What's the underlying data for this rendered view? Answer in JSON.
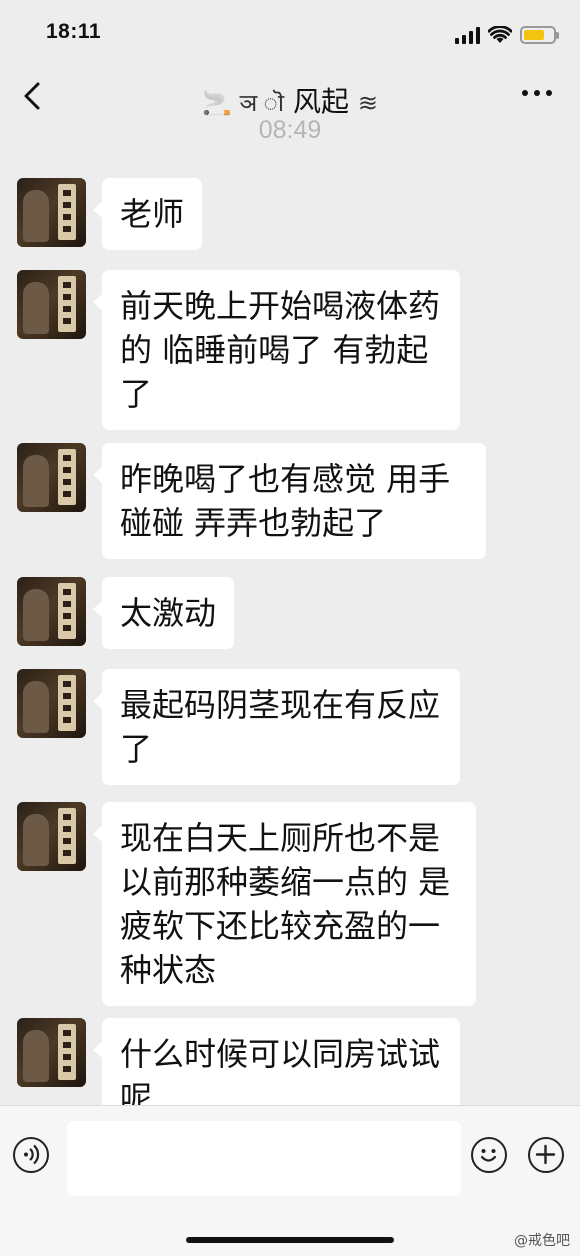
{
  "status_bar": {
    "time": "18:11"
  },
  "nav": {
    "title": "风起",
    "title_prefix": "🚬 ञ ॊ",
    "title_suffix": "≋"
  },
  "timestamp": "08:49",
  "messages": [
    {
      "text": "老师"
    },
    {
      "text": "前天晚上开始喝液体药的 临睡前喝了 有勃起了"
    },
    {
      "text": "昨晚喝了也有感觉  用手碰碰  弄弄也勃起了"
    },
    {
      "text": "太激动"
    },
    {
      "text": "最起码阴茎现在有反应了"
    },
    {
      "text": "现在白天上厕所也不是以前那种萎缩一点的 是疲软下还比较充盈的一种状态"
    },
    {
      "text": "什么时候可以同房试试呢"
    }
  ],
  "input": {
    "placeholder": ""
  },
  "watermark": "@戒色吧",
  "colors": {
    "background": "#ededed",
    "bubble": "#ffffff",
    "battery": "#f2c40f"
  }
}
